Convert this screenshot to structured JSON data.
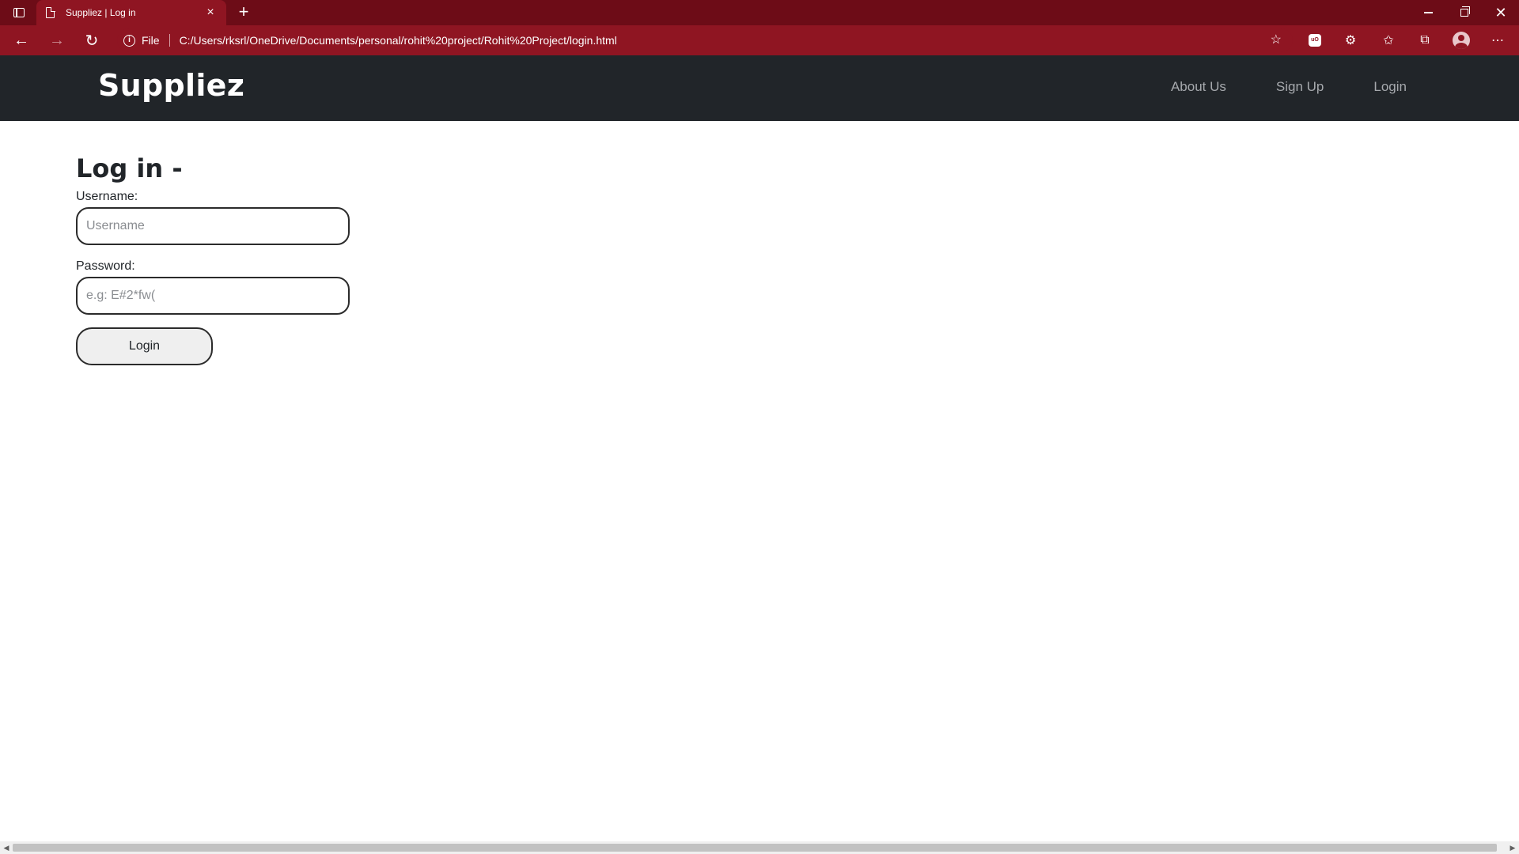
{
  "browser": {
    "tab_title": "Suppliez | Log in",
    "tab_close": "×",
    "new_tab": "+",
    "address": {
      "protocol": "File",
      "url": "C:/Users/rksrl/OneDrive/Documents/personal/rohit%20project/Rohit%20Project/login.html"
    },
    "extension_label": "uO",
    "icons": [
      "tab-actions-icon",
      "page-icon",
      "back-icon",
      "forward-icon",
      "reload-icon",
      "info-icon",
      "add-favorite-icon",
      "ublock-icon",
      "extensions-icon",
      "favorites-icon",
      "collections-icon",
      "profile-icon",
      "more-icon",
      "minimize-icon",
      "maximize-icon",
      "close-icon"
    ],
    "theme_color": "#8f1522",
    "tabstrip_color": "#6d0c17"
  },
  "navbar": {
    "brand": "Suppliez",
    "links": [
      "About Us",
      "Sign Up",
      "Login"
    ],
    "background": "#212529"
  },
  "login_form": {
    "heading": "Log in -",
    "username_label": "Username:",
    "username_placeholder": "Username",
    "username_value": "",
    "password_label": "Password:",
    "password_placeholder": "e.g: E#2*fw(",
    "password_value": "",
    "submit_label": "Login"
  }
}
